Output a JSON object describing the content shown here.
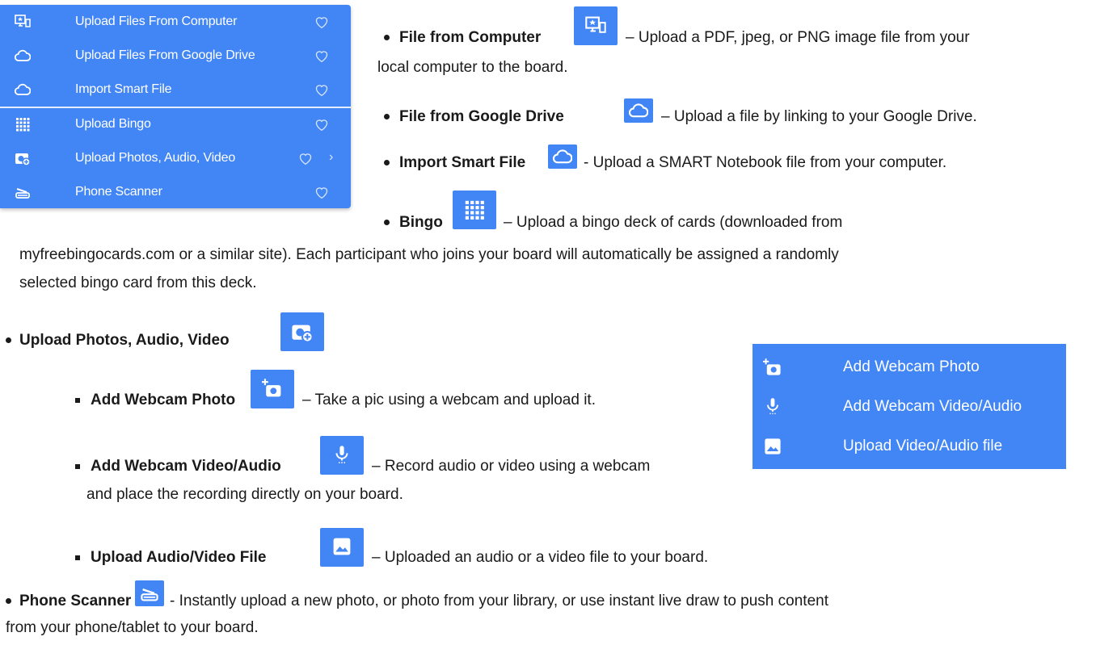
{
  "menu": {
    "items": [
      {
        "label": "Upload Files From Computer",
        "icon": "computer-upload-icon"
      },
      {
        "label": "Upload Files From Google Drive",
        "icon": "cloud-icon"
      },
      {
        "label": "Import Smart File",
        "icon": "cloud-icon"
      },
      {
        "label": "Upload Bingo",
        "icon": "bingo-grid-icon"
      },
      {
        "label": "Upload Photos, Audio, Video",
        "icon": "photo-plus-icon"
      },
      {
        "label": "Phone Scanner",
        "icon": "scanner-icon"
      }
    ],
    "chevron": "›"
  },
  "doc": {
    "file_computer": {
      "title": "File from Computer",
      "desc1": "– Upload a PDF, jpeg, or PNG image file from your",
      "desc2": "local computer to the board."
    },
    "google_drive": {
      "title": "File from Google Drive",
      "desc": "– Upload a file by linking to your Google Drive."
    },
    "smart_file": {
      "title": "Import Smart File",
      "desc": "- Upload a SMART Notebook file from your computer."
    },
    "bingo": {
      "title": "Bingo",
      "desc1": "– Upload a bingo deck of cards (downloaded from",
      "desc2": "myfreebingocards.com or a similar site). Each participant who joins your board will automatically be assigned a randomly",
      "desc3": "selected bingo card from this deck."
    },
    "photos": {
      "title": "Upload Photos, Audio, Video"
    },
    "webcam_photo": {
      "title": "Add Webcam Photo",
      "desc": "– Take a pic using a webcam and upload it."
    },
    "webcam_video": {
      "title": "Add Webcam Video/Audio",
      "desc1": "– Record audio or video using a webcam",
      "desc2": "and place the recording directly on your board."
    },
    "upload_av": {
      "title": "Upload Audio/Video File",
      "desc": "– Uploaded an audio or a video file to your board."
    },
    "scanner": {
      "title": "Phone Scanner",
      "desc1": "- Instantly upload a new photo, or photo from your library, or use instant live draw to push content",
      "desc2": "from your phone/tablet to your board."
    }
  },
  "submenu": {
    "items": [
      {
        "label": "Add Webcam Photo",
        "icon": "camera-plus-icon"
      },
      {
        "label": "Add Webcam Video/Audio",
        "icon": "microphone-icon"
      },
      {
        "label": "Upload Video/Audio file",
        "icon": "image-icon"
      }
    ]
  },
  "colors": {
    "accent": "#4285f4",
    "text": "#1a1a1a"
  }
}
